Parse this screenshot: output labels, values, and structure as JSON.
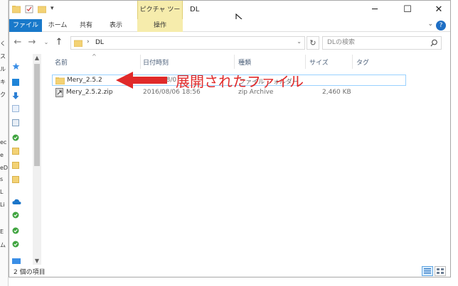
{
  "window": {
    "title": "DL",
    "context_tab": "ピクチャ ツール",
    "controls": {
      "minimize": "─",
      "maximize": "☐",
      "close": "✕"
    }
  },
  "ribbon": {
    "tabs": [
      "ファイル",
      "ホーム",
      "共有",
      "表示"
    ],
    "context_sub_tab": "操作",
    "help": "?"
  },
  "address": {
    "path": "DL",
    "separator": "›",
    "search_placeholder": "DLの検索"
  },
  "columns": [
    "名前",
    "日付時刻",
    "種類",
    "サイズ",
    "タグ"
  ],
  "files": [
    {
      "name": "Mery_2.5.2",
      "date": "2016/08/0",
      "type": "ファイル フォルダー",
      "size": ""
    },
    {
      "name": "Mery_2.5.2.zip",
      "date": "2016/08/06 18:56",
      "type": "zip Archive",
      "size": "2,460 KB"
    }
  ],
  "status": {
    "count": "2 個の項目"
  },
  "annotation": {
    "text": "展開されたファイル",
    "color": "#e02a2a"
  },
  "left_edge_fragments": [
    "く",
    "ス",
    "ル",
    "キ",
    "ク",
    "ec",
    "e",
    "eD",
    "s",
    "L",
    "Li",
    "E",
    "ム"
  ],
  "colors": {
    "accent": "#1979ca",
    "context_tab": "#f6ecac",
    "annotation": "#e02a2a",
    "folder": "#f3d275"
  },
  "icons": [
    "folder-icon",
    "zip-file-icon",
    "back-arrow-icon",
    "forward-arrow-icon",
    "up-arrow-icon",
    "search-icon",
    "help-icon",
    "quick-access-star-icon",
    "onedrive-icon",
    "computer-icon"
  ]
}
